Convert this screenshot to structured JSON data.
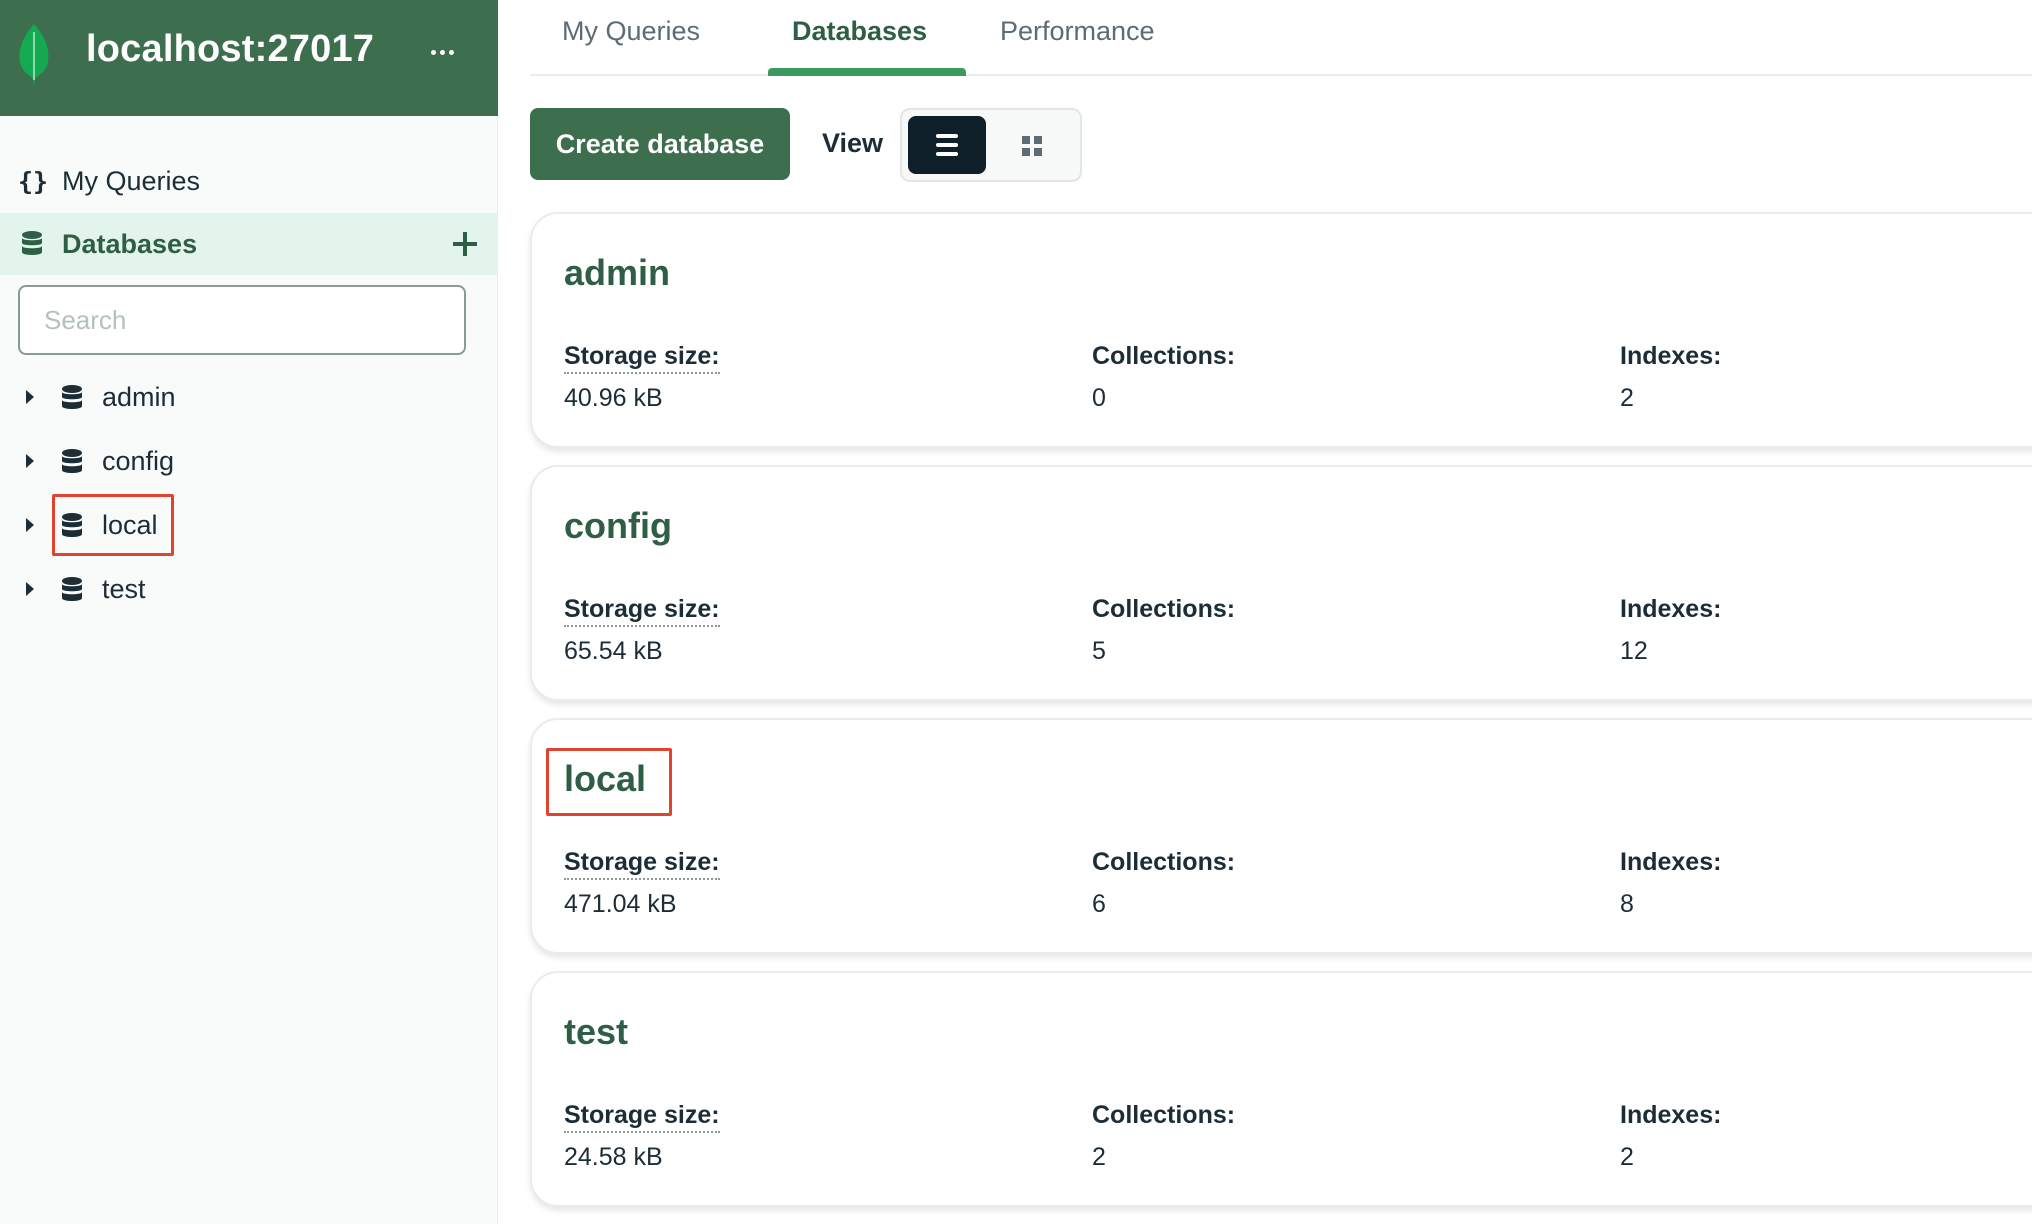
{
  "sidebar": {
    "connection_title": "localhost:27017",
    "nav": {
      "my_queries": "My Queries",
      "databases": "Databases"
    },
    "search": {
      "placeholder": "Search",
      "value": ""
    },
    "tree": [
      {
        "label": "admin"
      },
      {
        "label": "config"
      },
      {
        "label": "local"
      },
      {
        "label": "test"
      }
    ]
  },
  "tabs": [
    {
      "label": "My Queries"
    },
    {
      "label": "Databases"
    },
    {
      "label": "Performance"
    }
  ],
  "active_tab": "Databases",
  "toolbar": {
    "create_label": "Create database",
    "view_label": "View",
    "view_mode": "list"
  },
  "cards": [
    {
      "name": "admin",
      "storage_label": "Storage size:",
      "storage": "40.96 kB",
      "collections_label": "Collections:",
      "collections": "0",
      "indexes_label": "Indexes:",
      "indexes": "2"
    },
    {
      "name": "config",
      "storage_label": "Storage size:",
      "storage": "65.54 kB",
      "collections_label": "Collections:",
      "collections": "5",
      "indexes_label": "Indexes:",
      "indexes": "12"
    },
    {
      "name": "local",
      "storage_label": "Storage size:",
      "storage": "471.04 kB",
      "collections_label": "Collections:",
      "collections": "6",
      "indexes_label": "Indexes:",
      "indexes": "8"
    },
    {
      "name": "test",
      "storage_label": "Storage size:",
      "storage": "24.58 kB",
      "collections_label": "Collections:",
      "collections": "2",
      "indexes_label": "Indexes:",
      "indexes": "2"
    }
  ],
  "colors": {
    "brand_green": "#3d6f4f",
    "accent_green": "#3d9a5e",
    "highlight_red": "#e0432f"
  }
}
